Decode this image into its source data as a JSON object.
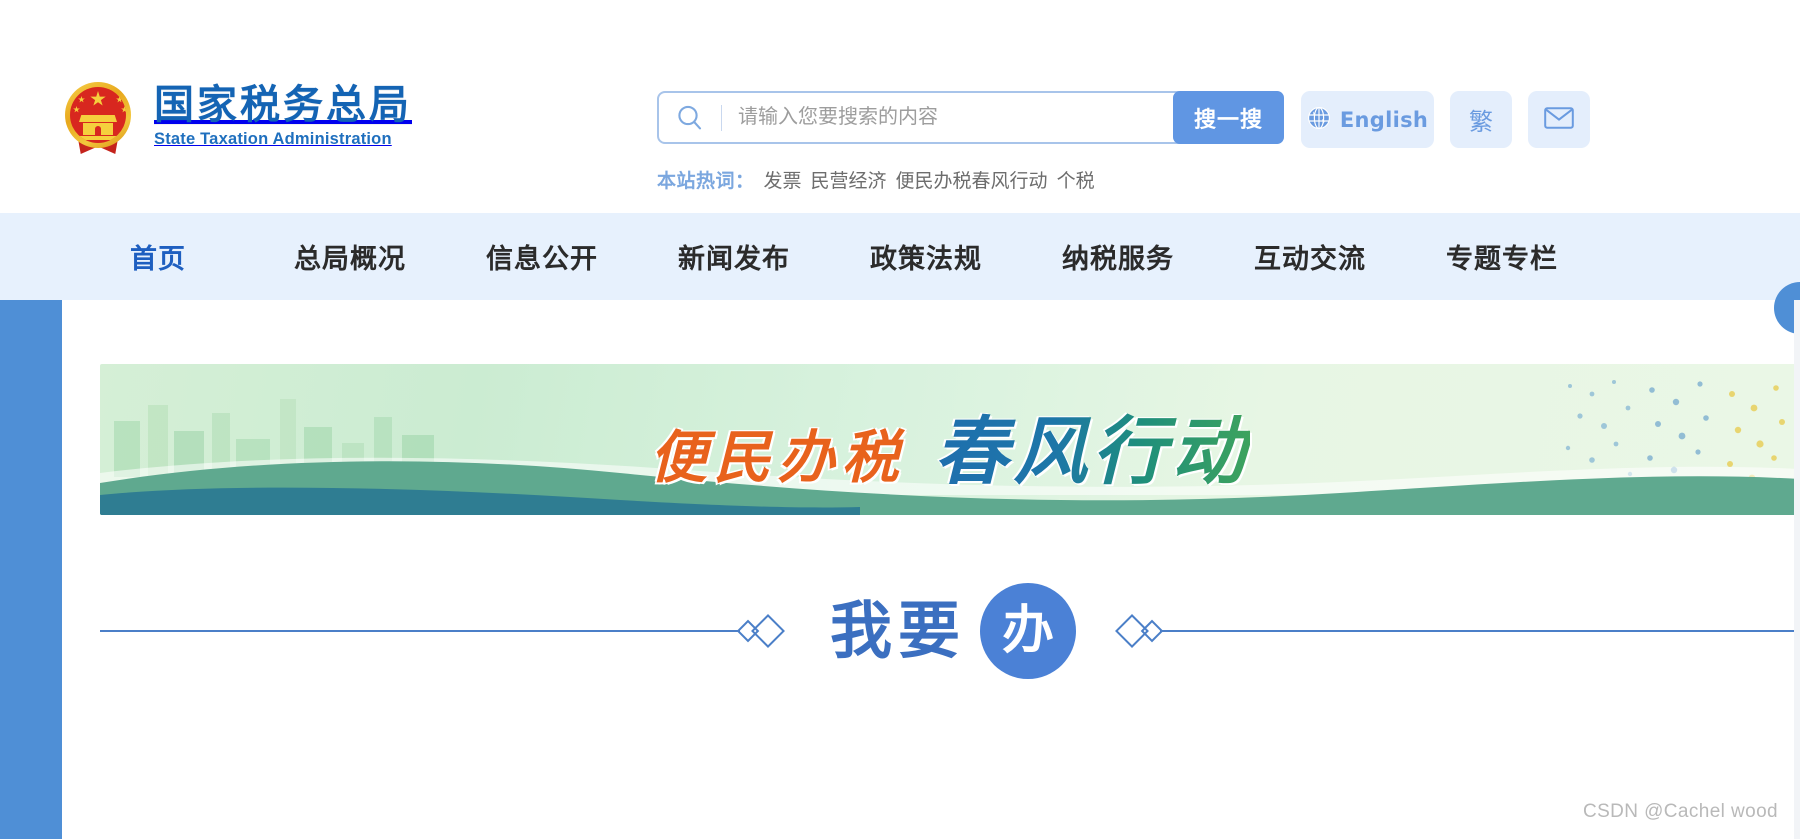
{
  "site": {
    "brand_cn": "国家税务总局",
    "brand_en": "State Taxation Administration",
    "emblem_icon": "national-emblem-icon",
    "accent_blue": "#1464b4",
    "nav_bg": "#e7f1fd",
    "page_bg": "#4f8fd6"
  },
  "search": {
    "icon": "search-icon",
    "value": "",
    "placeholder": "请输入您要搜索的内容",
    "button_label": "搜一搜",
    "button_color": "#6096e3"
  },
  "hotwords": {
    "label": "本站热词：",
    "items": [
      "发票",
      "民营经济",
      "便民办税春风行动",
      "个税"
    ]
  },
  "top_tools": [
    {
      "name": "english",
      "label": "English",
      "icon": "globe-icon"
    },
    {
      "name": "traditional-chinese",
      "label": "繁",
      "icon": ""
    },
    {
      "name": "mail",
      "label": "✉",
      "icon": "envelope-icon"
    }
  ],
  "nav": {
    "items": [
      {
        "label": "首页",
        "active": true
      },
      {
        "label": "总局概况",
        "active": false
      },
      {
        "label": "信息公开",
        "active": false
      },
      {
        "label": "新闻发布",
        "active": false
      },
      {
        "label": "政策法规",
        "active": false
      },
      {
        "label": "纳税服务",
        "active": false
      },
      {
        "label": "互动交流",
        "active": false
      },
      {
        "label": "专题专栏",
        "active": false
      }
    ]
  },
  "banner": {
    "title_part1": "便民办税",
    "title_part2": "春风行动",
    "part1_color": "#e8621c",
    "part2_color": "#1f6fae"
  },
  "section": {
    "title": "我要",
    "badge": "办",
    "badge_color": "#4b81d6",
    "rule_color": "#4b7fc8"
  },
  "watermark": "CSDN @Cachel wood"
}
